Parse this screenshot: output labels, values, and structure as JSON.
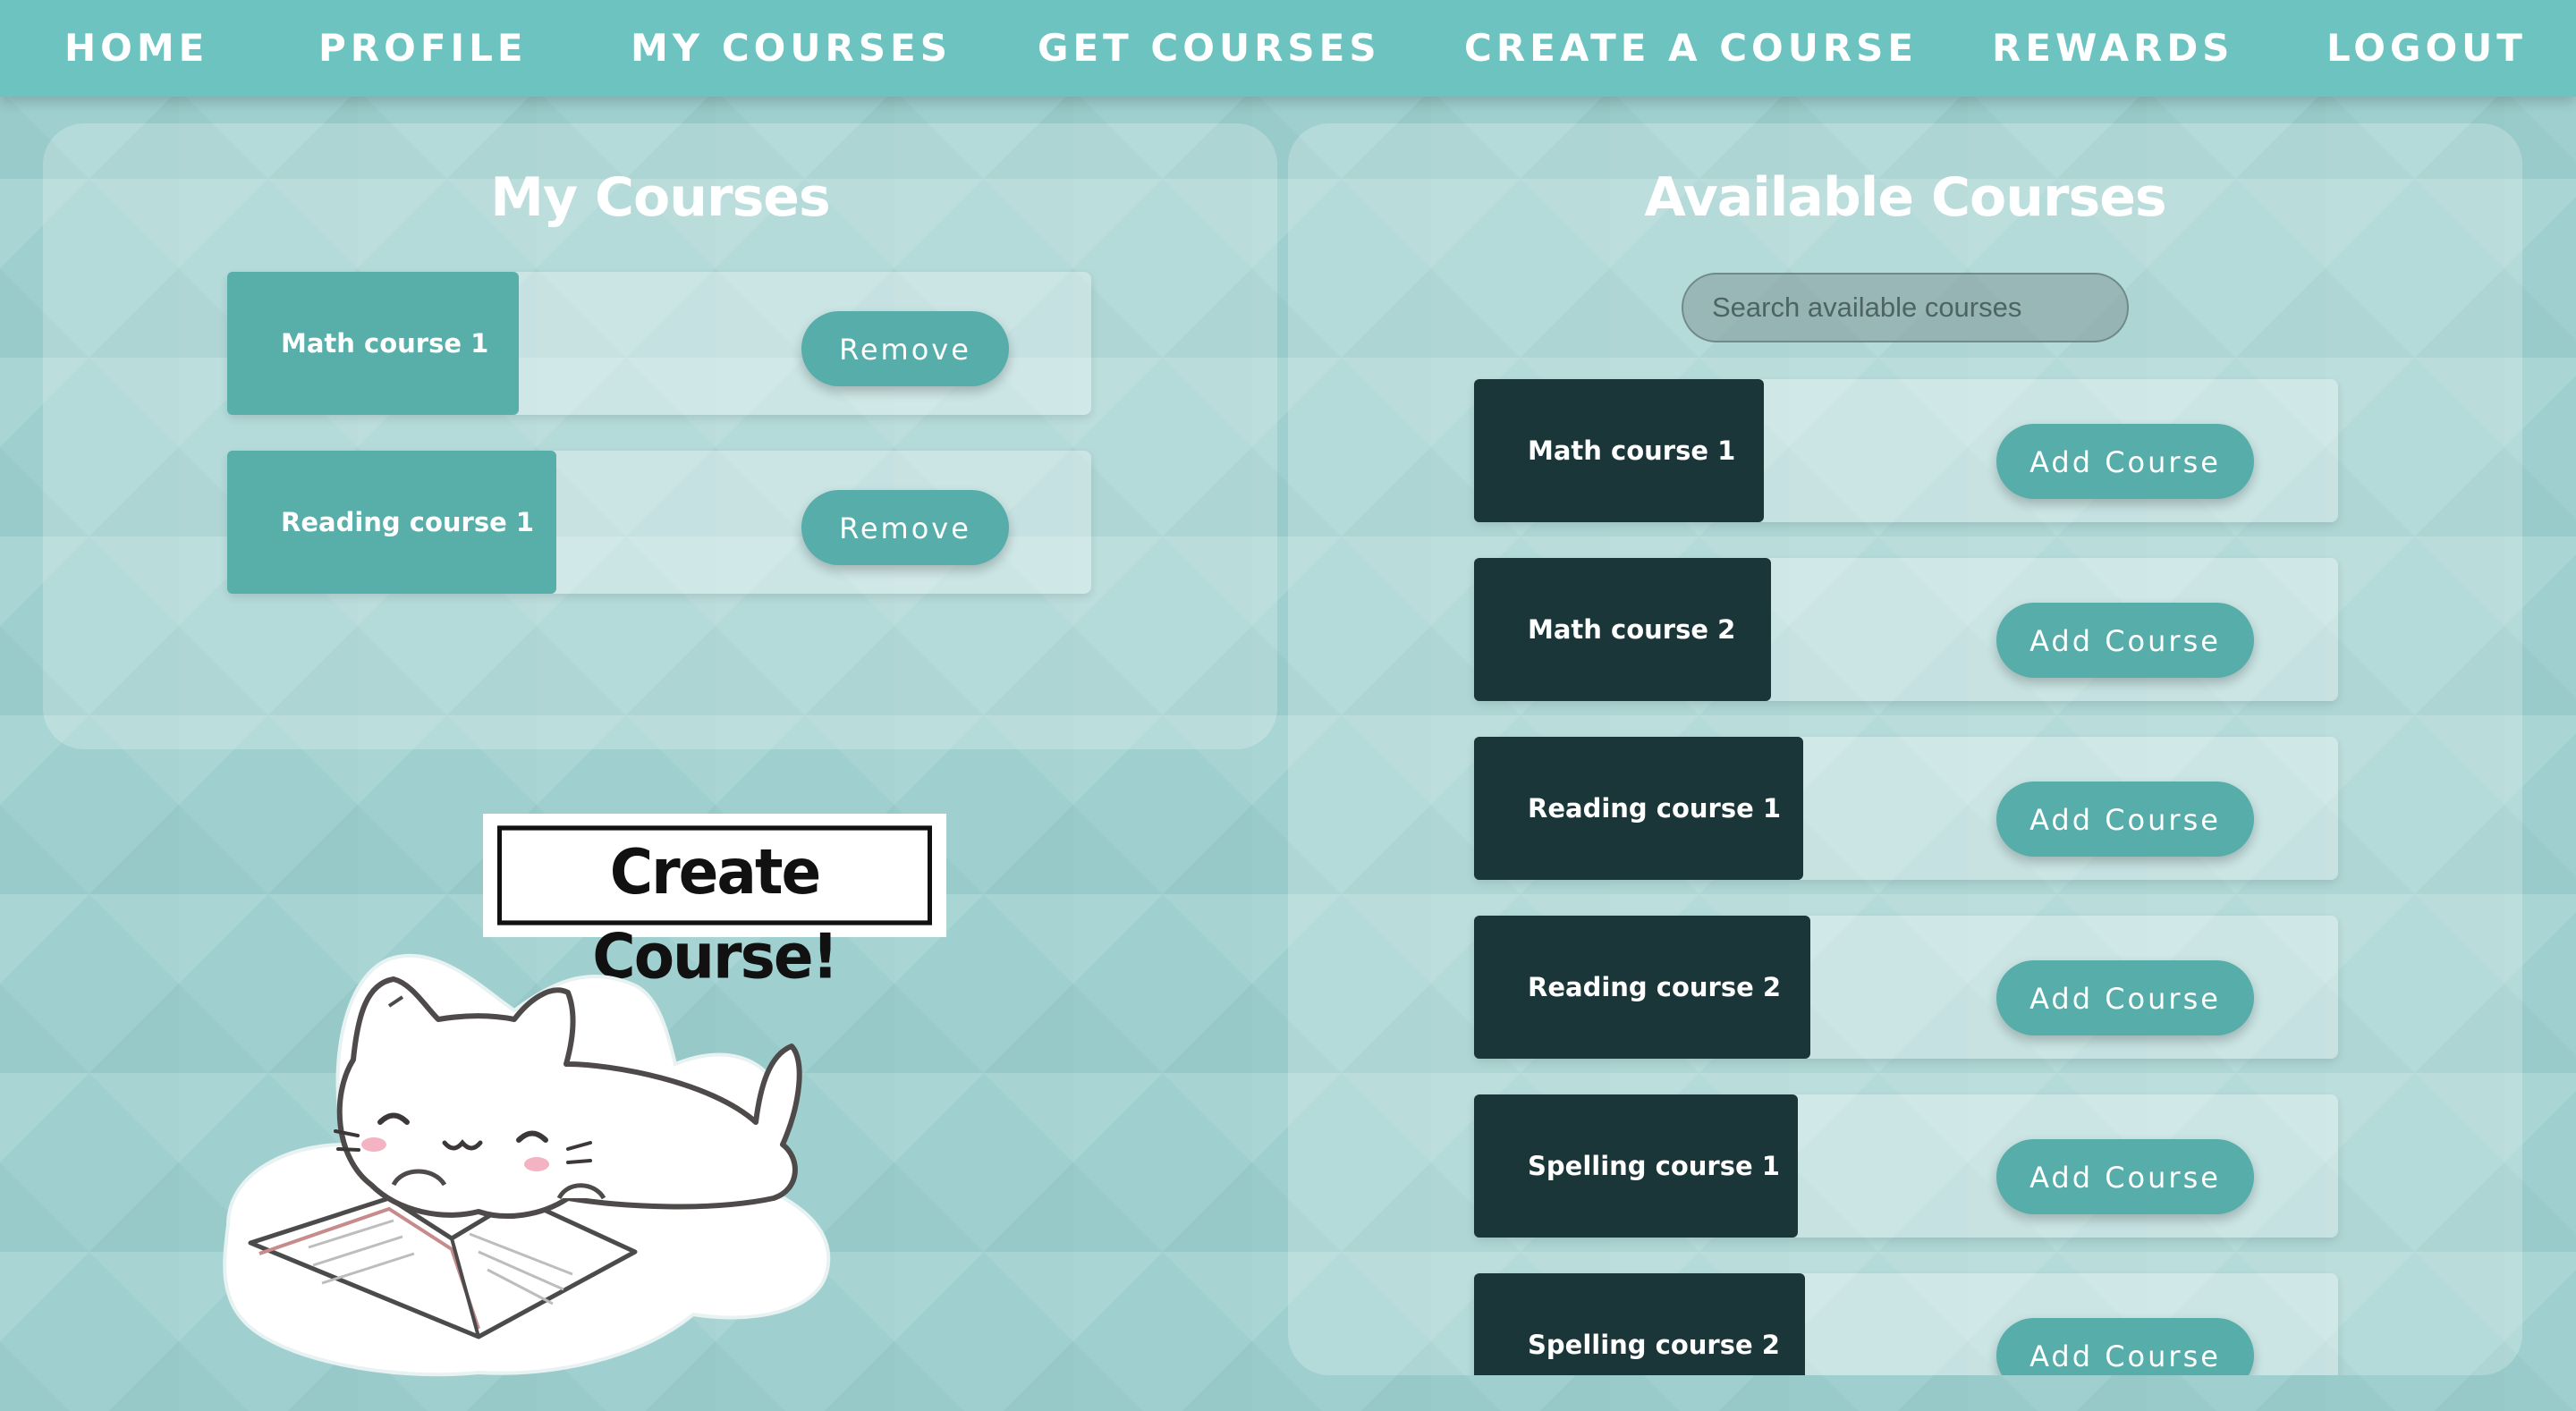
{
  "nav": {
    "items": [
      {
        "label": "HOME"
      },
      {
        "label": "PROFILE"
      },
      {
        "label": "MY COURSES"
      },
      {
        "label": "GET COURSES"
      },
      {
        "label": "CREATE A COURSE"
      },
      {
        "label": "REWARDS"
      },
      {
        "label": "LOGOUT"
      }
    ]
  },
  "my_courses": {
    "title": "My Courses",
    "button_label": "Remove",
    "items": [
      {
        "name": "Math course 1"
      },
      {
        "name": "Reading course 1"
      }
    ]
  },
  "available_courses": {
    "title": "Available Courses",
    "search_placeholder": "Search available courses",
    "button_label": "Add Course",
    "items": [
      {
        "name": "Math course 1"
      },
      {
        "name": "Math course 2"
      },
      {
        "name": "Reading course 1"
      },
      {
        "name": "Reading course 2"
      },
      {
        "name": "Spelling course 1"
      },
      {
        "name": "Spelling course 2"
      }
    ]
  },
  "create_sticker": {
    "label": "Create Course!"
  },
  "colors": {
    "nav": "#6cc3c0",
    "my_course_tile": "#58aea9",
    "available_course_tile": "#1a3638",
    "button": "#56adaa"
  }
}
